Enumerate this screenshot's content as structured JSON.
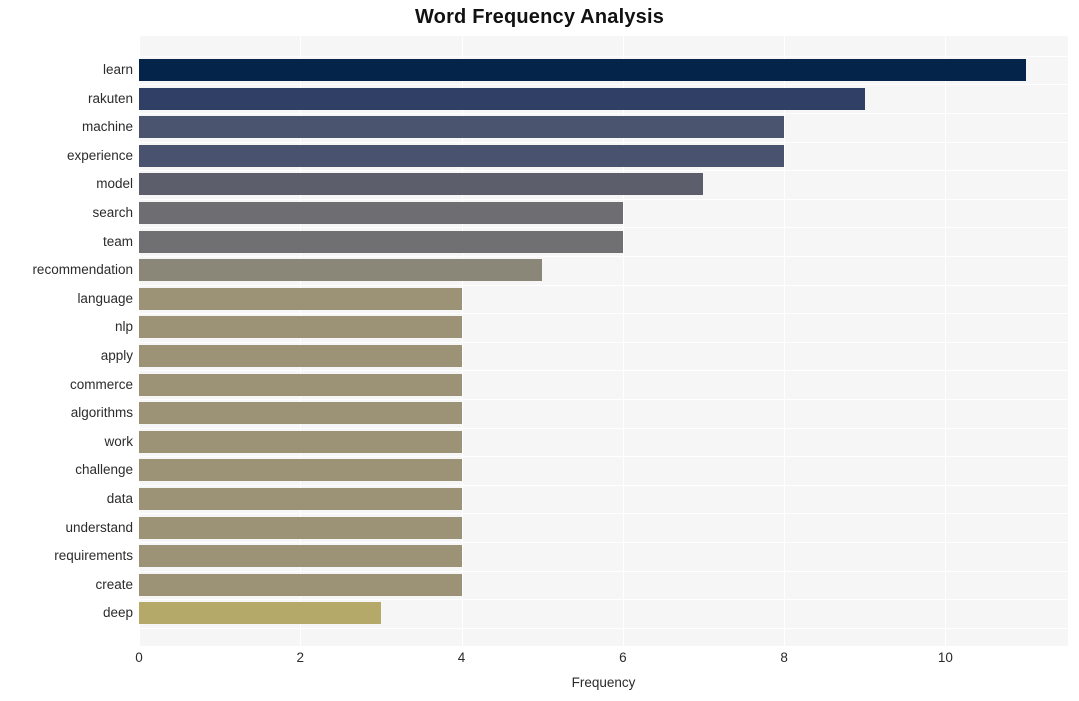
{
  "chart_data": {
    "type": "bar",
    "orientation": "horizontal",
    "title": "Word Frequency Analysis",
    "xlabel": "Frequency",
    "ylabel": "",
    "categories": [
      "learn",
      "rakuten",
      "machine",
      "experience",
      "model",
      "search",
      "team",
      "recommendation",
      "language",
      "nlp",
      "apply",
      "commerce",
      "algorithms",
      "work",
      "challenge",
      "data",
      "understand",
      "requirements",
      "create",
      "deep"
    ],
    "values": [
      11,
      9,
      8,
      8,
      7,
      6,
      6,
      5,
      4,
      4,
      4,
      4,
      4,
      4,
      4,
      4,
      4,
      4,
      4,
      3
    ],
    "bar_colors": [
      "#042449",
      "#2f3f66",
      "#4b546f",
      "#49526e",
      "#5c5f6b",
      "#6e6e72",
      "#707073",
      "#8a8778",
      "#9c9377",
      "#9c9377",
      "#9c9377",
      "#9c9377",
      "#9c9377",
      "#9c9377",
      "#9c9377",
      "#9c9377",
      "#9c9377",
      "#9c9377",
      "#9c9377",
      "#b5a96a"
    ],
    "xticks": [
      0,
      2,
      4,
      6,
      8,
      10
    ],
    "xtick_labels": [
      "0",
      "2",
      "4",
      "6",
      "8",
      "10"
    ],
    "xlim": [
      0,
      11.52
    ],
    "grid": true,
    "grid_color": "#ffffff",
    "plot_background": "#f6f6f7",
    "figure_background": "#ffffff",
    "legend": null,
    "title_color": "#111111",
    "tick_color": "#2b2b2b"
  }
}
